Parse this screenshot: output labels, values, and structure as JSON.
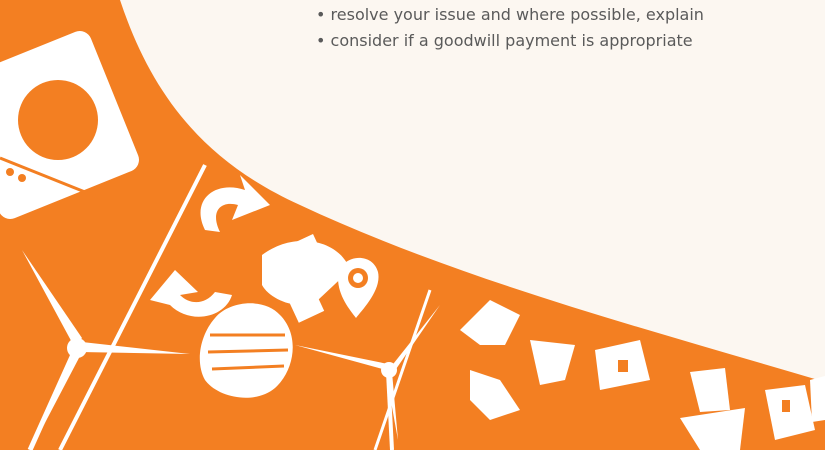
{
  "bullets": [
    "resolve your issue and where possible, explain",
    "consider if a goodwill payment is appropriate"
  ],
  "colors": {
    "cream": "#fcf7f1",
    "orange": "#f37f22",
    "icon": "#ffffff",
    "text": "#5a5a5a"
  },
  "icons": [
    "washing-machine-icon",
    "wind-turbine-icon",
    "recycle-arrows-icon",
    "light-bulb-icon",
    "location-pin-icon",
    "house-icon"
  ]
}
